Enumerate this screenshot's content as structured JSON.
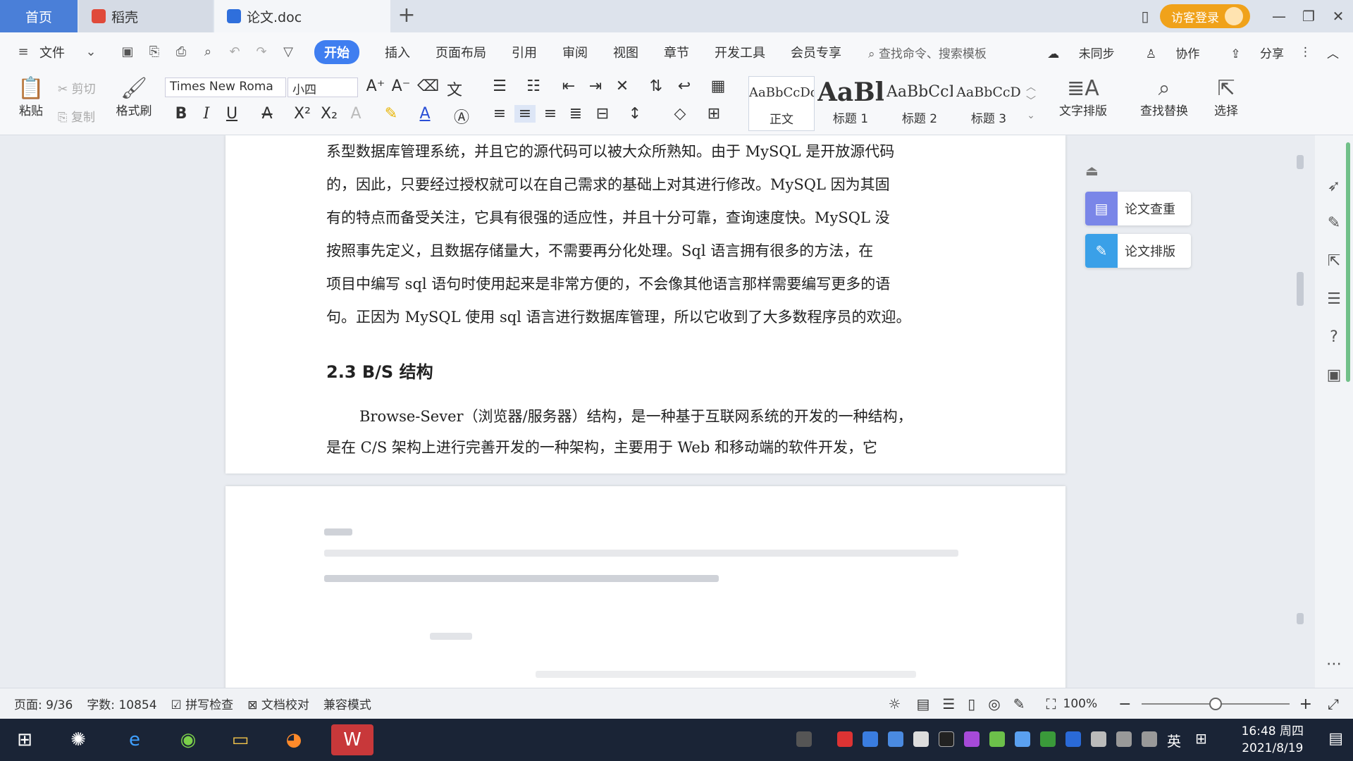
{
  "tabs": {
    "home": "首页",
    "daoke": "稻壳",
    "doc": "论文.doc",
    "new_tab": "+"
  },
  "window": {
    "login": "访客登录",
    "minimize": "—",
    "restore": "❐",
    "close": "✕"
  },
  "menu": {
    "file": "文件",
    "items": [
      "开始",
      "插入",
      "页面布局",
      "引用",
      "审阅",
      "视图",
      "章节",
      "开发工具",
      "会员专享"
    ],
    "search_placeholder": "查找命令、搜索模板",
    "unsynced": "未同步",
    "collab": "协作",
    "share": "分享"
  },
  "ribbon": {
    "paste": "粘贴",
    "cut": "剪切",
    "copy": "复制",
    "format_painter": "格式刷",
    "font_name": "Times New Roma",
    "font_size": "小四",
    "styles": [
      {
        "preview": "AaBbCcDd",
        "label": "正文"
      },
      {
        "preview": "AaBl",
        "label": "标题 1"
      },
      {
        "preview": "AaBbCcI",
        "label": "标题 2"
      },
      {
        "preview": "AaBbCcD",
        "label": "标题 3"
      }
    ],
    "text_layout": "文字排版",
    "find_replace": "查找替换",
    "select": "选择"
  },
  "document": {
    "lines": [
      "系型数据库管理系统，并且它的源代码可以被大众所熟知。由于 MySQL 是开放源代码",
      "的，因此，只要经过授权就可以在自己需求的基础上对其进行修改。MySQL 因为其固",
      "有的特点而备受关注，它具有很强的适应性，并且十分可靠，查询速度快。MySQL 没",
      "按照事先定义，且数据存储量大，不需要再分化处理。Sql 语言拥有很多的方法，在",
      "项目中编写 sql 语句时使用起来是非常方便的，不会像其他语言那样需要编写更多的语",
      "句。正因为 MySQL 使用 sql 语言进行数据库管理，所以它收到了大多数程序员的欢迎。"
    ],
    "heading": "2.3 B/S 结构",
    "para2_line1": "Browse-Sever（浏览器/服务器）结构，是一种基于互联网系统的开发的一种结构，",
    "para2_line2": "是在 C/S 架构上进行完善开发的一种架构，主要用于 Web 和移动端的软件开发，它"
  },
  "side_panel": {
    "check": "论文查重",
    "layout": "论文排版"
  },
  "status": {
    "page": "页面: 9/36",
    "words": "字数: 10854",
    "spell": "拼写检查",
    "proof": "文档校对",
    "compat": "兼容模式",
    "zoom": "100%"
  },
  "taskbar": {
    "ime": "英",
    "time": "16:48 周四",
    "date": "2021/8/19"
  },
  "colors": {
    "accent": "#3f7ef0",
    "tab_active": "#4a7fd8",
    "login": "#f0a21a",
    "taskbar": "#1a2436"
  }
}
